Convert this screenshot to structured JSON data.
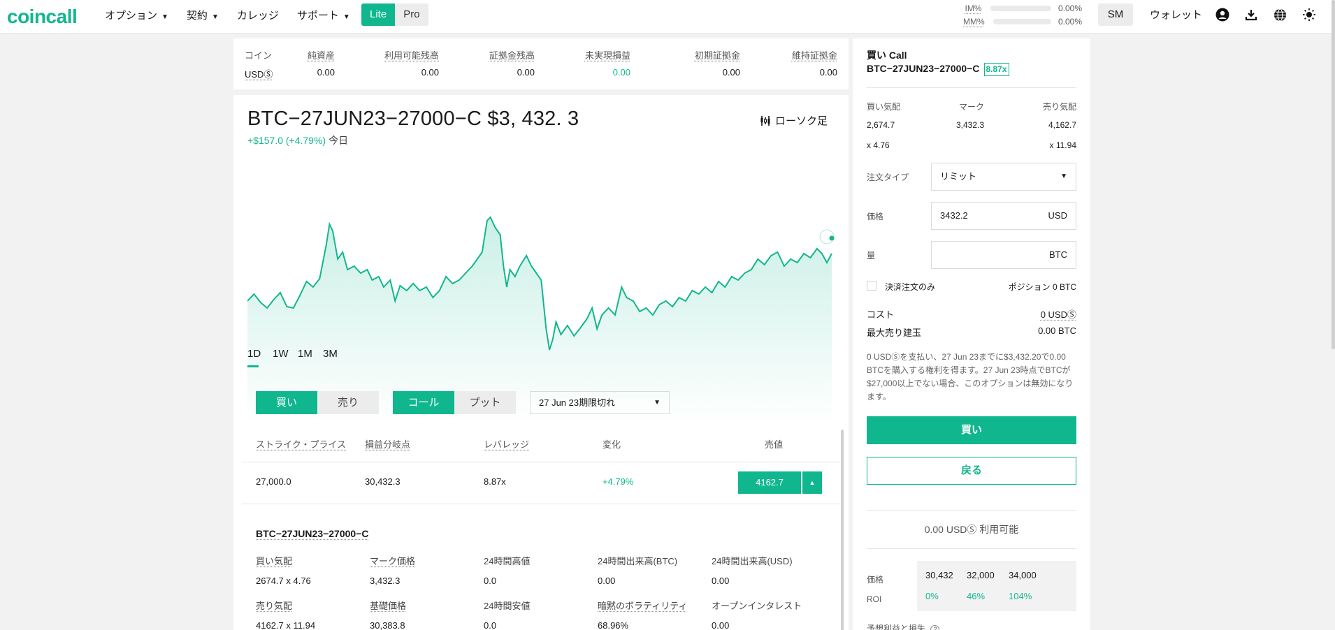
{
  "header": {
    "logo": "coincall",
    "nav": [
      {
        "label": "オプション",
        "dropdown": true
      },
      {
        "label": "契約",
        "dropdown": true
      },
      {
        "label": "カレッジ",
        "dropdown": false
      },
      {
        "label": "サポート",
        "dropdown": true
      }
    ],
    "mode_lite": "Lite",
    "mode_pro": "Pro",
    "im_label": "IM%",
    "im_value": "0.00%",
    "mm_label": "MM%",
    "mm_value": "0.00%",
    "account": "SM",
    "wallet": "ウォレット",
    "icons": [
      "user-icon",
      "download-icon",
      "globe-icon",
      "theme-icon"
    ]
  },
  "balances": {
    "headers": [
      "コイン",
      "純資産",
      "利用可能残高",
      "証拠金残高",
      "未実現損益",
      "初期証拠金",
      "維持証拠金"
    ],
    "values": [
      "USDⓈ",
      "0.00",
      "0.00",
      "0.00",
      "0.00",
      "0.00",
      "0.00"
    ]
  },
  "instrument": {
    "title": "BTC−27JUN23−27000−C $3, 432. 3",
    "change": "+$157.0 (+4.79%)",
    "today": "今日",
    "candle_label": "ローソク足",
    "ranges": [
      "1D",
      "1W",
      "1M",
      "3M"
    ]
  },
  "controls": {
    "buy": "買い",
    "sell": "売り",
    "call": "コール",
    "put": "プット",
    "expiry": "27 Jun 23期限切れ"
  },
  "table": {
    "headers": [
      "ストライク・プライス",
      "損益分岐点",
      "レバレッジ",
      "変化",
      "売値"
    ],
    "row": {
      "strike": "27,000.0",
      "breakeven": "30,432.3",
      "leverage": "8.87x",
      "change": "+4.79%",
      "ask": "4162.7"
    }
  },
  "details": {
    "title": "BTC−27JUN23−27000−C",
    "row1": [
      {
        "k": "買い気配",
        "v": "2674.7 x 4.76"
      },
      {
        "k": "マーク価格",
        "v": "3,432.3"
      },
      {
        "k": "24時間高値",
        "v": "0.0"
      },
      {
        "k": "24時間出来高(BTC)",
        "v": "0.00"
      },
      {
        "k": "24時間出来高(USD)",
        "v": "0.00"
      }
    ],
    "row2": [
      {
        "k": "売り気配",
        "v": "4162.7 x 11.94"
      },
      {
        "k": "基礎価格",
        "v": "30,383.8"
      },
      {
        "k": "24時間安値",
        "v": "0.0"
      },
      {
        "k": "暗黙のボラティリティ",
        "v": "68.96%"
      },
      {
        "k": "オープンインタレスト",
        "v": "0.00"
      }
    ]
  },
  "order": {
    "side_title": "買い Call",
    "instrument": "BTC−27JUN23−27000−C",
    "leverage_badge": "8.87x",
    "bid_label": "買い気配",
    "mark_label": "マーク",
    "ask_label": "売り気配",
    "bid": "2,674.7",
    "mark": "3,432.3",
    "ask": "4,162.7",
    "bid_size": "x 4.76",
    "ask_size": "x 11.94",
    "order_type_label": "注文タイプ",
    "order_type": "リミット",
    "price_label": "価格",
    "price_value": "3432.2",
    "price_unit": "USD",
    "qty_label": "量",
    "qty_unit": "BTC",
    "reduce_only": "決済注文のみ",
    "position": "ポジション 0 BTC",
    "cost_label": "コスト",
    "cost_value": "0 USDⓈ",
    "max_sell_label": "最大売り建玉",
    "max_sell_value": "0.00 BTC",
    "note": "0 USDⓈを支払い、27 Jun 23までに$3,432.20で0.00 BTCを購入する権利を得ます。27 Jun 23時点でBTCが$27,000以上でない場合、このオプションは無効になります。",
    "buy_button": "買い",
    "back_button": "戻る",
    "available": "0.00 USDⓈ 利用可能",
    "roi": {
      "price_label": "価格",
      "roi_label": "ROI",
      "prices": [
        "30,432",
        "32,000",
        "34,000"
      ],
      "rois": [
        "0%",
        "46%",
        "104%"
      ]
    },
    "expected_pl": "予想利益と損失"
  },
  "colors": {
    "accent": "#10b78e",
    "panel": "#ffffff",
    "background": "#f2f2f2"
  }
}
